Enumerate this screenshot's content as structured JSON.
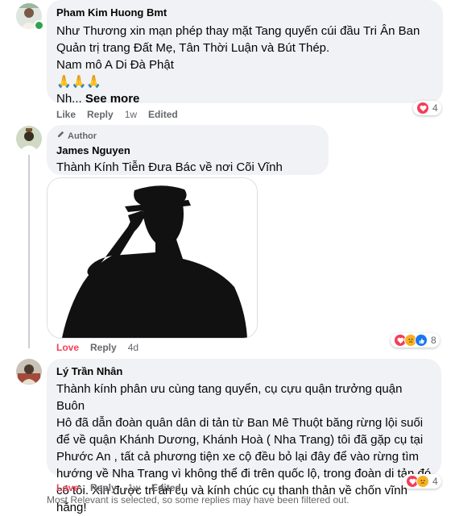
{
  "comments": [
    {
      "name": "Pham Kim Huong Bmt",
      "lines": [
        "Như Thương xin mạn phép thay mặt Tang quyến cúi đầu Tri Ân Ban",
        "Quản trị trang Đất Mẹ, Tân Thời Luận và Bút Thép.",
        "Nam mô A Di Đà Phật",
        "🙏🙏🙏",
        "Nh..."
      ],
      "see_more": "See more",
      "actions": {
        "like": "Like",
        "reply": "Reply",
        "time": "1w",
        "edited": "Edited"
      },
      "reaction_count": "4"
    },
    {
      "badge": "Author",
      "name": "James Nguyen",
      "text": "Thành Kính Tiễn Đưa Bác về nơi Cõi Vĩnh Hằng....!",
      "actions": {
        "love": "Love",
        "reply": "Reply",
        "time": "4d"
      },
      "reaction_count": "8"
    },
    {
      "name": "Lý Trần Nhân",
      "lines": [
        "Thành kính phân ưu cùng tang quyển, cụ cựu quận trưởng quận Buôn",
        "Hô đã dẫn đoàn quân dân di tản từ Ban Mê Thuột băng rừng lội suối",
        "để về quận Khánh Dương, Khánh Hoà ( Nha Trang) tôi đã gặp cụ tại",
        "Phước An , tất cả phương tiện xe cộ đều bỏ lại đây để vào rừng tìm",
        "hướng về Nha Trang vì không thể đi trên quốc lộ, trong đoàn di tản đó",
        "có tôi. Xin được tri ân cụ và kính chúc cụ thanh thản về chốn vĩnh hằng!"
      ],
      "actions": {
        "love": "Love",
        "reply": "Reply",
        "time": "1w",
        "edited": "Edited"
      },
      "reaction_count": "4"
    }
  ],
  "footer": "Most Relevant is selected, so some replies may have been filtered out.",
  "colors": {
    "love": "#f33e58",
    "like": "#1877f2",
    "sad": "#f7b125",
    "bubble": "#f0f2f5"
  }
}
